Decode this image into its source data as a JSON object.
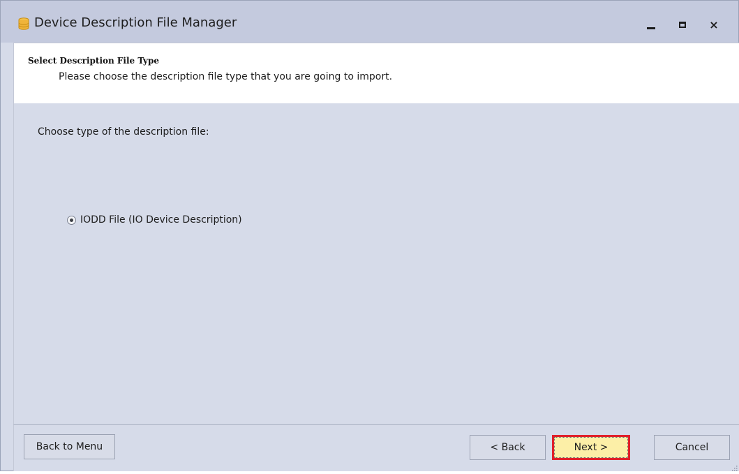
{
  "window": {
    "title": "Device Description File Manager",
    "app_icon": "database-icon",
    "controls": {
      "minimize_icon": "minimize-icon",
      "maximize_icon": "maximize-icon",
      "close_icon": "close-icon",
      "close_glyph": "×"
    }
  },
  "header": {
    "title": "Select Description File Type",
    "subtitle": "Please choose the description file type that you are going to import."
  },
  "content": {
    "prompt": "Choose type of the description file:",
    "options": [
      {
        "label": "IODD File (IO Device Description)",
        "selected": true
      }
    ]
  },
  "footer": {
    "back_to_menu": "Back to Menu",
    "back": "< Back",
    "next": "Next >",
    "cancel": "Cancel"
  },
  "colors": {
    "titlebar": "#c4cade",
    "body": "#d6dbe9",
    "header_panel": "#ffffff",
    "next_button": "#fcefa7",
    "highlight_border": "#e0202a"
  }
}
